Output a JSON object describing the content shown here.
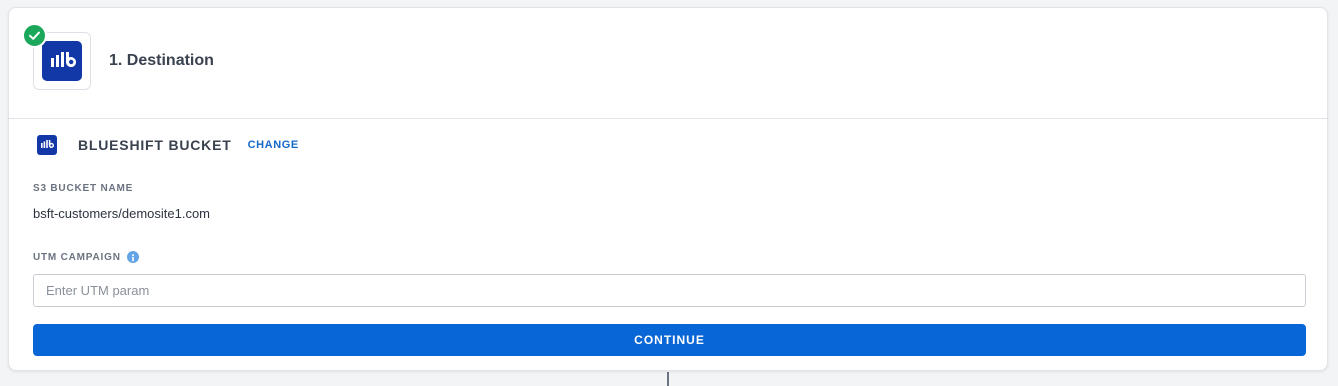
{
  "step": {
    "title": "1. Destination",
    "status": "completed"
  },
  "destination": {
    "name": "BLUESHIFT BUCKET",
    "change_label": "CHANGE"
  },
  "fields": {
    "s3_bucket": {
      "label": "S3 BUCKET NAME",
      "value": "bsft-customers/demosite1.com"
    },
    "utm_campaign": {
      "label": "UTM CAMPAIGN",
      "value": "",
      "placeholder": "Enter UTM param"
    }
  },
  "actions": {
    "continue_label": "CONTINUE"
  },
  "icons": {
    "brand_logo": "blueshift-logo-icon",
    "status": "check-icon",
    "info": "info-icon"
  },
  "colors": {
    "primary": "#0966d6",
    "brand": "#1237a6",
    "success": "#1ca85a",
    "link": "#1569c7"
  }
}
